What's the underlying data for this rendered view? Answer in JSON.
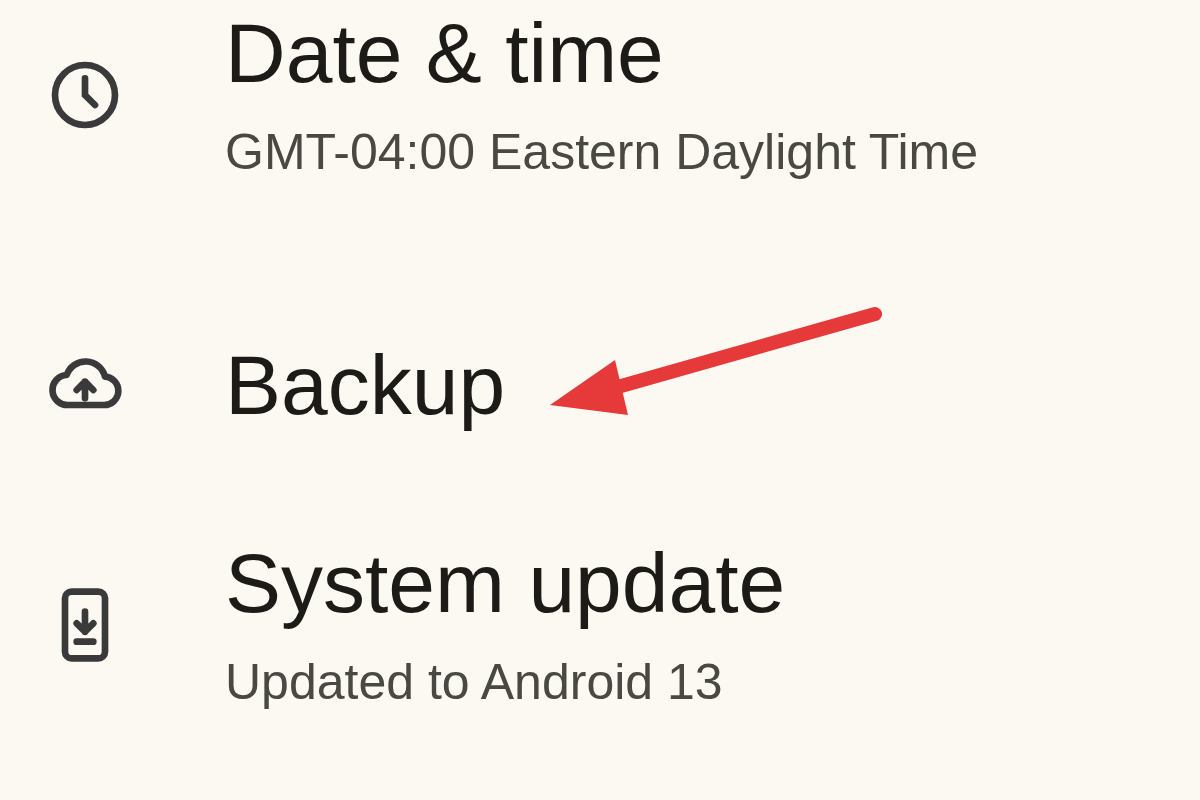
{
  "settings_items": [
    {
      "kind": "clock",
      "title": "Date & time",
      "subtitle": "GMT-04:00 Eastern Daylight Time"
    },
    {
      "kind": "backup",
      "title": "Backup"
    },
    {
      "kind": "update",
      "title": "System update",
      "subtitle": "Updated to Android 13"
    }
  ]
}
